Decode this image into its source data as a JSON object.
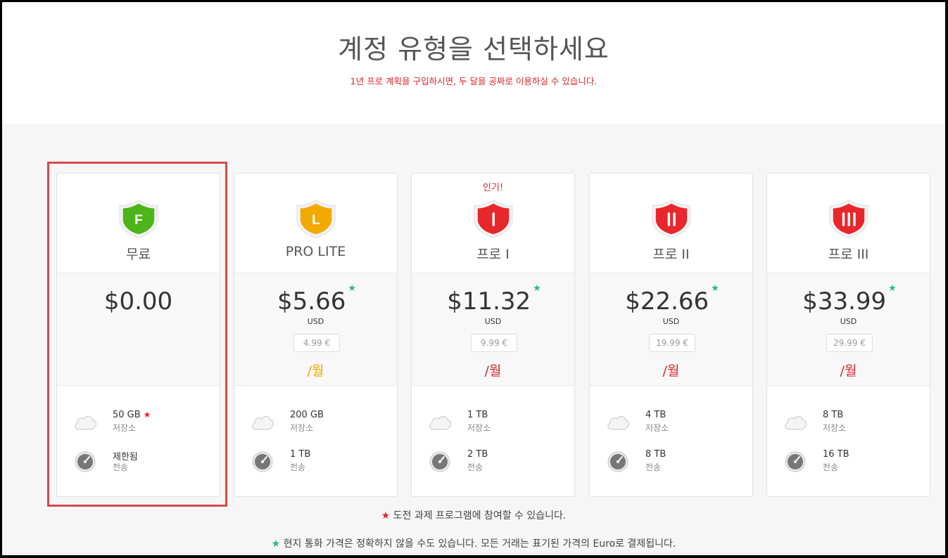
{
  "header": {
    "title": "계정 유형을 선택하세요",
    "subtitle": "1년 프로 계획을 구입하시면, 두 달을 공짜로 이용하실 수 있습니다."
  },
  "colors": {
    "accent_red": "#d9272e",
    "teal_star": "#2bb39a",
    "free_green": "#4cb517",
    "lite_orange": "#f2a900",
    "pro_red": "#e8272c"
  },
  "plans": [
    {
      "badge_letter": "F",
      "badge_color": "#4cb517",
      "name": "무료",
      "popular": "",
      "price": "$0.00",
      "currency": "",
      "euro": "",
      "period": "",
      "storage_value": "50 GB",
      "storage_star": "★",
      "storage_label": "저장소",
      "transfer_value": "제한됨",
      "transfer_label": "전송",
      "selected": true
    },
    {
      "badge_letter": "L",
      "badge_color": "#f2a900",
      "name": "PRO LITE",
      "popular": "",
      "price": "$5.66",
      "currency": "USD",
      "euro": "4.99 €",
      "period": "/월",
      "period_color": "#f2a900",
      "storage_value": "200 GB",
      "storage_star": "",
      "storage_label": "저장소",
      "transfer_value": "1 TB",
      "transfer_label": "전송"
    },
    {
      "badge_letter": "I",
      "badge_color": "#e8272c",
      "name": "프로 I",
      "popular": "인기!",
      "price": "$11.32",
      "currency": "USD",
      "euro": "9.99 €",
      "period": "/월",
      "period_color": "#d9272e",
      "storage_value": "1 TB",
      "storage_star": "",
      "storage_label": "저장소",
      "transfer_value": "2 TB",
      "transfer_label": "전송"
    },
    {
      "badge_letter": "II",
      "badge_color": "#e8272c",
      "name": "프로 II",
      "popular": "",
      "price": "$22.66",
      "currency": "USD",
      "euro": "19.99 €",
      "period": "/월",
      "period_color": "#d9272e",
      "storage_value": "4 TB",
      "storage_star": "",
      "storage_label": "저장소",
      "transfer_value": "8 TB",
      "transfer_label": "전송"
    },
    {
      "badge_letter": "III",
      "badge_color": "#e8272c",
      "name": "프로 III",
      "popular": "",
      "price": "$33.99",
      "currency": "USD",
      "euro": "29.99 €",
      "period": "/월",
      "period_color": "#d9272e",
      "storage_value": "8 TB",
      "storage_star": "",
      "storage_label": "저장소",
      "transfer_value": "16 TB",
      "transfer_label": "전송"
    }
  ],
  "price_star": "★",
  "icons": {
    "storage": "cloud-icon",
    "transfer": "speedometer-icon"
  },
  "footnotes": {
    "challenge_star": "★",
    "challenge": "도전 과제 프로그램에 참여할 수 있습니다.",
    "currency_star": "★",
    "currency": "현지 통화 가격은 정확하지 않을 수도 있습니다. 모든 거래는 표기된 가격의 Euro로 결제됩니다."
  }
}
